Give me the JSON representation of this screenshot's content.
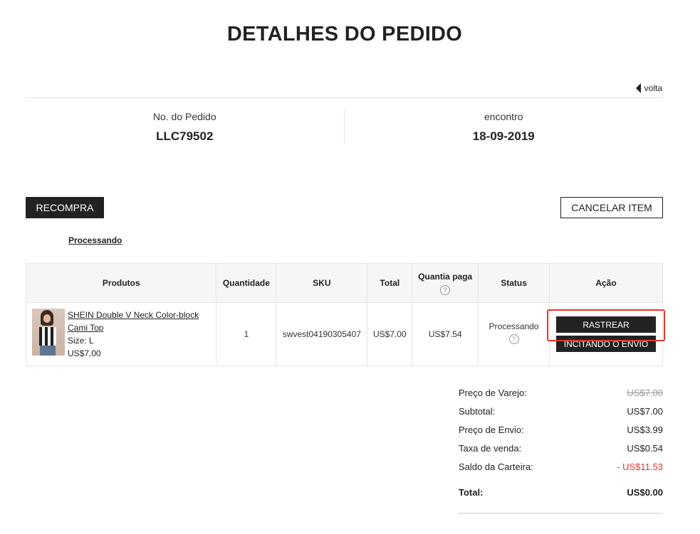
{
  "page": {
    "title": "DETALHES DO PEDIDO",
    "back_label": "volta"
  },
  "order": {
    "number_label": "No. do Pedido",
    "number_value": "LLC79502",
    "date_label": "encontro",
    "date_value": "18-09-2019"
  },
  "actions": {
    "recompra_label": "RECOMPRA",
    "cancel_label": "CANCELAR ITEM"
  },
  "status_link": "Processando",
  "table": {
    "headers": {
      "produtos": "Produtos",
      "quantidade": "Quantidade",
      "sku": "SKU",
      "total": "Total",
      "quantia_paga": "Quantia paga",
      "status": "Status",
      "acao": "Ação"
    },
    "help_glyph": "?",
    "row": {
      "product_name": "SHEIN Double V Neck Color-block Cami Top",
      "size": "Size: L",
      "price": "US$7.00",
      "quantity": "1",
      "sku": "swvest04190305407",
      "total": "US$7.00",
      "paid": "US$7.54",
      "status": "Processando",
      "track_label": "RASTREAR",
      "ship_label": "INCITANDO O ENVIO"
    }
  },
  "summary": {
    "retail_label": "Preço de Varejo:",
    "retail_value": "US$7.00",
    "subtotal_label": "Subtotal:",
    "subtotal_value": "US$7.00",
    "shipping_label": "Preço de Envio:",
    "shipping_value": "US$3.99",
    "tax_label": "Taxa de venda:",
    "tax_value": "US$0.54",
    "wallet_label": "Saldo da Carteira:",
    "wallet_value": "- US$11.53",
    "total_label": "Total:",
    "total_value": "US$0.00"
  },
  "colors": {
    "dark_button": "#222222",
    "highlight": "#e8352c",
    "negative": "#e8352c",
    "header_bg": "#f6f6f6"
  },
  "icons": {
    "back": "caret-left-icon",
    "help": "question-circle-icon"
  }
}
